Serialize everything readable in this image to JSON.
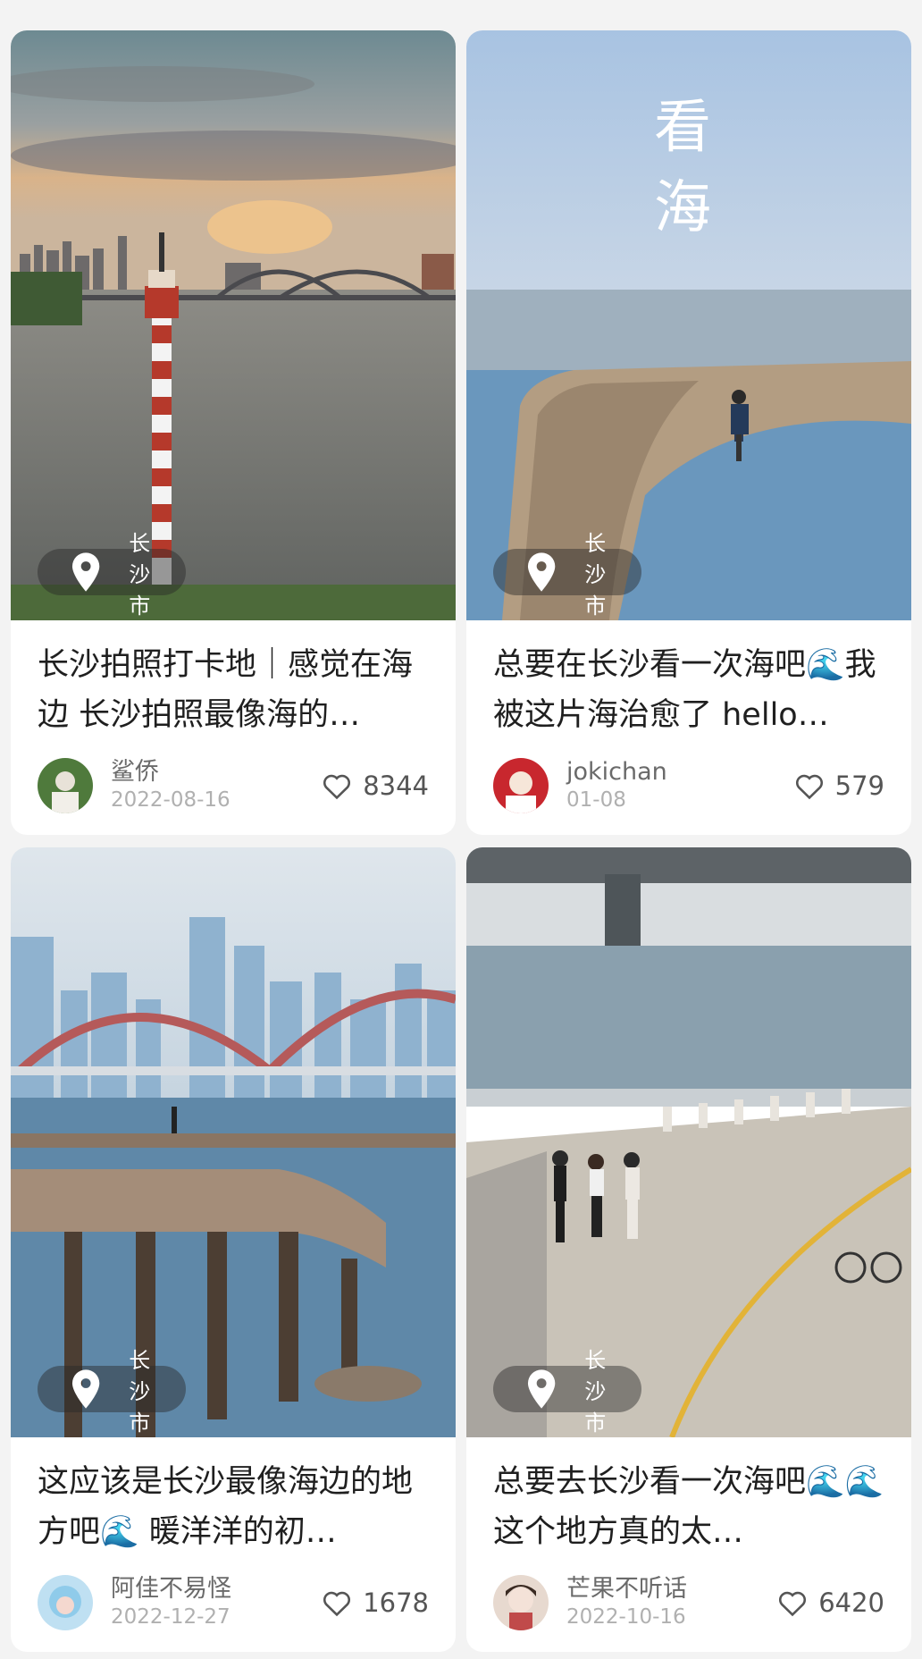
{
  "cards": [
    {
      "location": "长沙市",
      "title": "长沙拍照打卡地｜感觉在海边 长沙拍照最像海的…",
      "author": "鲨侨",
      "date": "2022-08-16",
      "likes": "8344"
    },
    {
      "location": "长沙市",
      "title": "总要在长沙看一次海吧🌊我被这片海治愈了 hello…",
      "author": "jokichan",
      "date": "01-08",
      "likes": "579",
      "image_text": "看海"
    },
    {
      "location": "长沙市",
      "title": "这应该是长沙最像海边的地方吧🌊 暖洋洋的初…",
      "author": "阿佳不易怪",
      "date": "2022-12-27",
      "likes": "1678"
    },
    {
      "location": "长沙市",
      "title": "总要去长沙看一次海吧🌊🌊 这个地方真的太…",
      "author": "芒果不听话",
      "date": "2022-10-16",
      "likes": "6420"
    }
  ],
  "icons": {
    "location": "location-pin-icon",
    "like": "heart-outline-icon"
  }
}
